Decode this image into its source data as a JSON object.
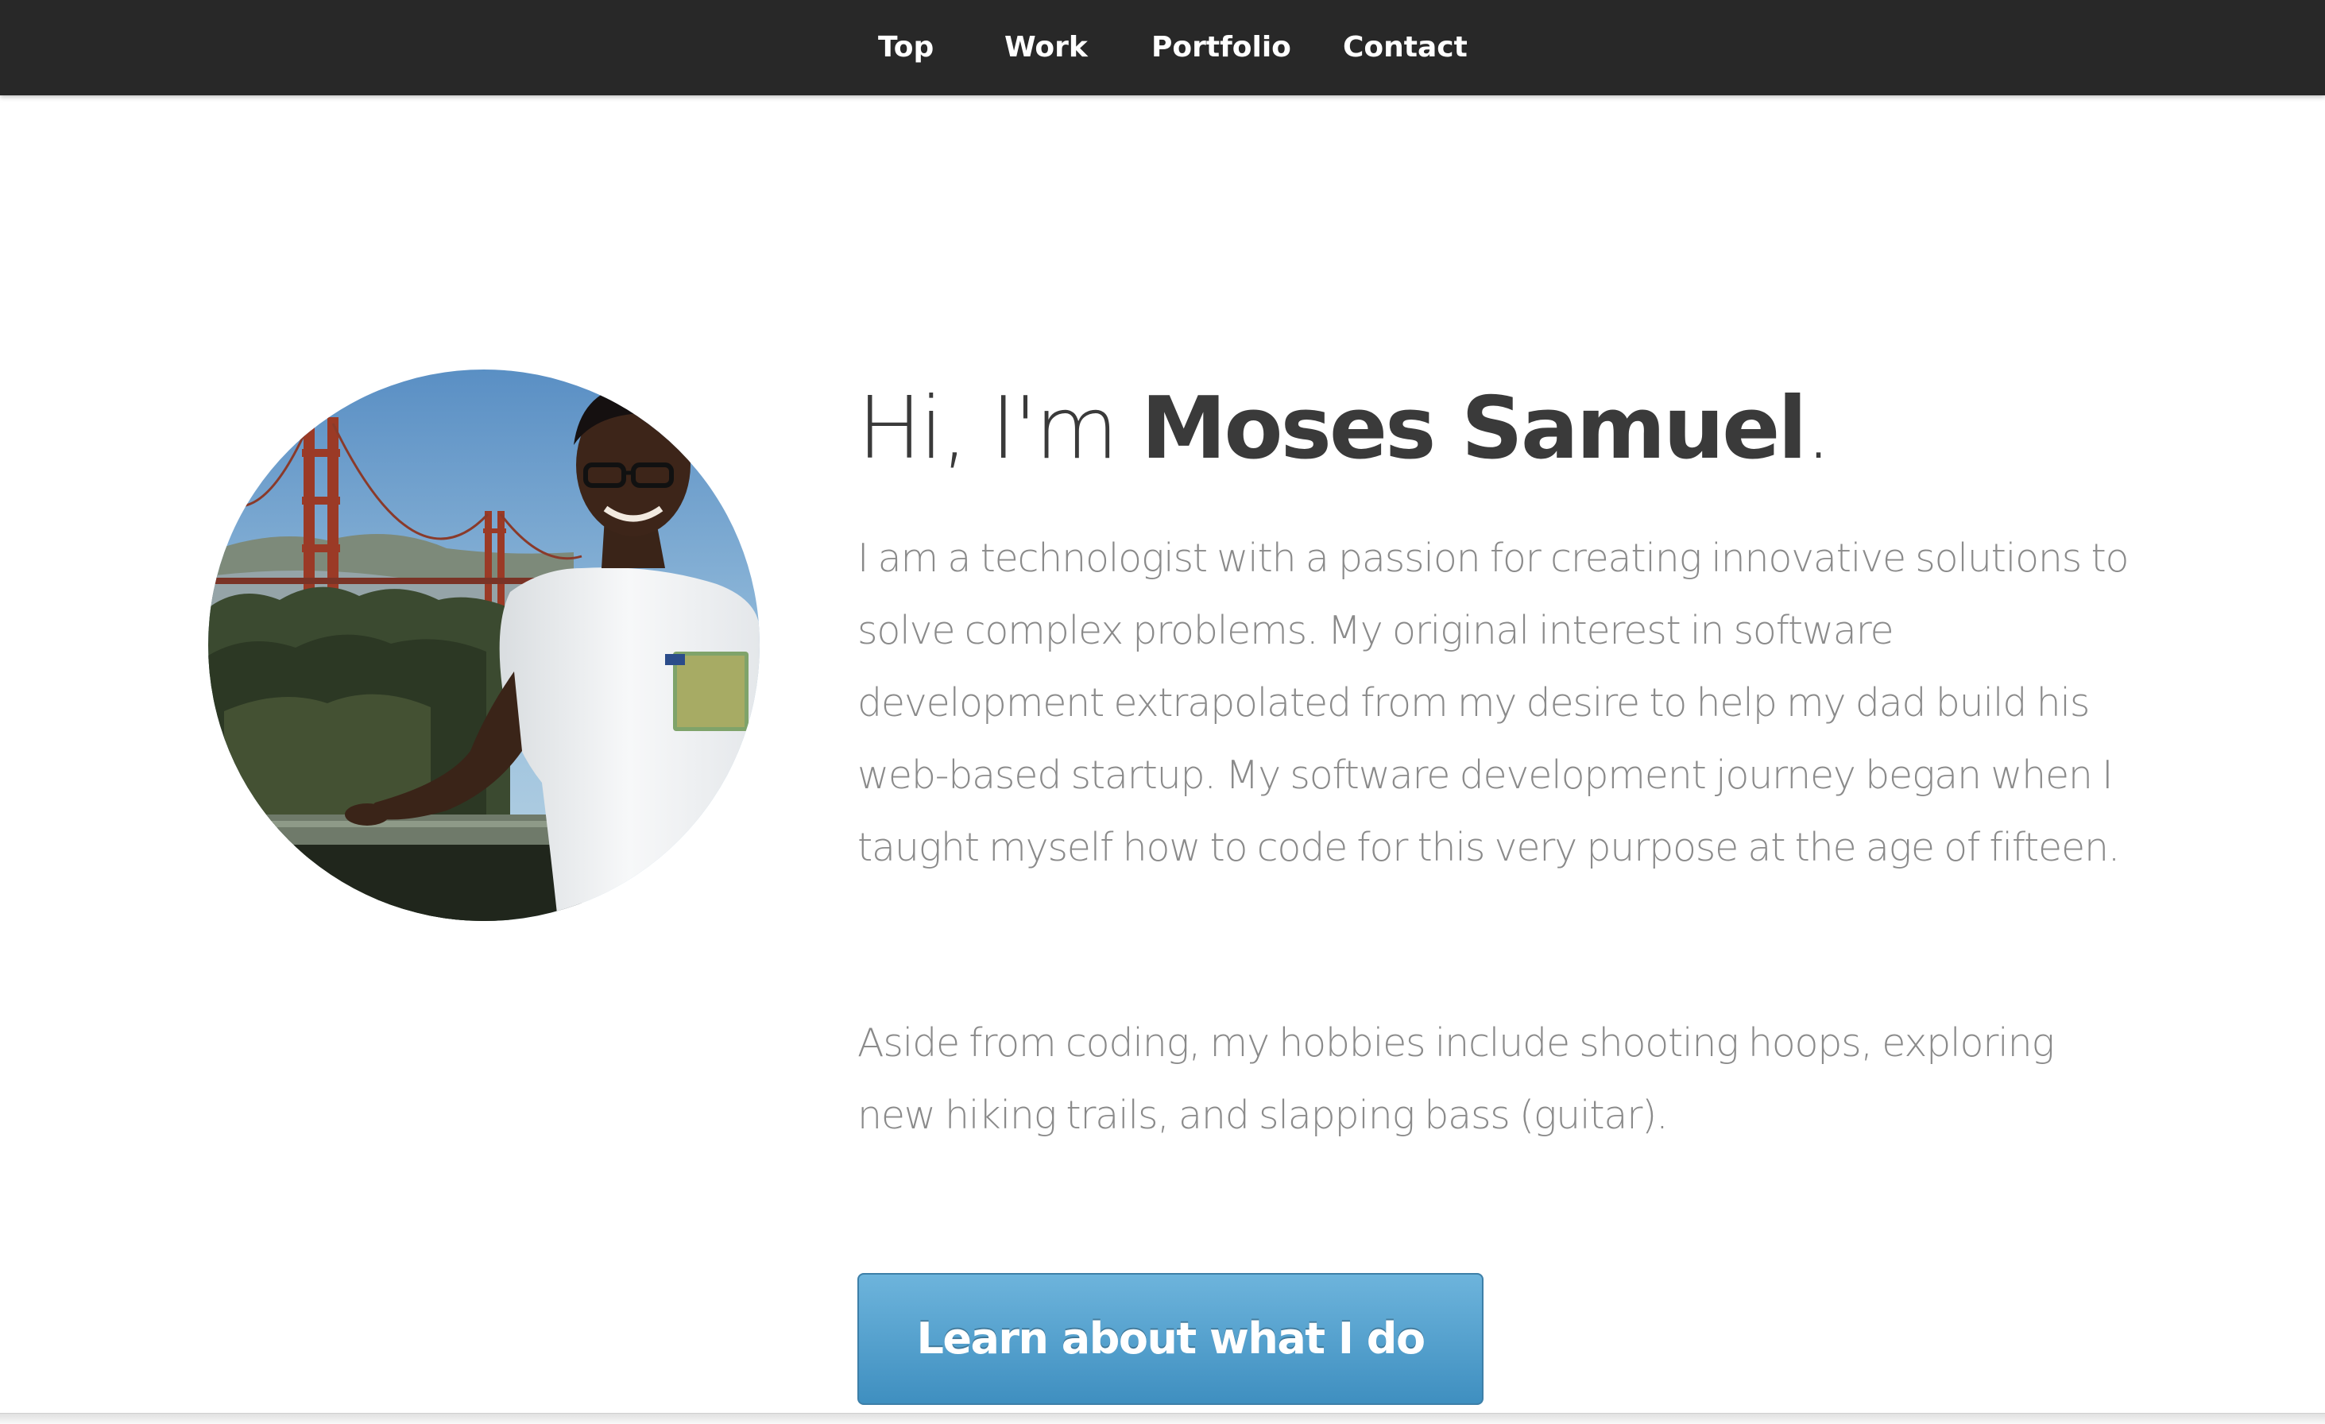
{
  "nav": {
    "items": [
      {
        "label": "Top"
      },
      {
        "label": "Work"
      },
      {
        "label": "Portfolio"
      },
      {
        "label": "Contact"
      }
    ]
  },
  "intro": {
    "greeting": "Hi, I'm ",
    "name": "Moses Samuel",
    "punct": ".",
    "bio_paragraphs": [
      "I am a technologist with a passion for creating innovative solutions to solve complex problems. My original interest in software development extrapolated from my desire to help my dad build his web-based startup. My software development journey began when I taught myself how to code for this very purpose at the age of fifteen.",
      "Aside from coding, my hobbies include shooting hoops, exploring new hiking trails, and slapping bass (guitar)."
    ],
    "cta_label": "Learn about what I do"
  },
  "avatar": {
    "icon": "profile-photo"
  },
  "colors": {
    "navbar": "#282828",
    "button": "#4a9ccb",
    "heading": "#3a3a3a",
    "body_text": "#8a8a8a"
  }
}
